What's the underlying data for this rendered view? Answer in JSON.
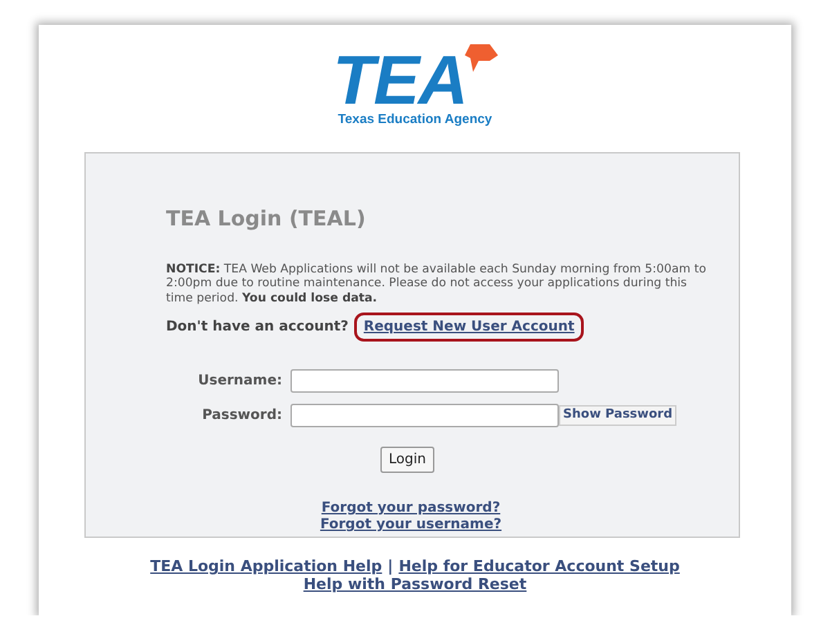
{
  "logo": {
    "wordmark": "TEA",
    "tagline": "Texas Education Agency"
  },
  "login": {
    "title": "TEA Login (TEAL)",
    "notice": "**NOTICE:**  TEA Web Applications will not be available each Sunday morning from 5:00am to 2:00pm due to routine maintenance. Please do not access your applications during this time period. **You could lose data.**",
    "account_prompt": "Don't have an account?",
    "request_link": {
      "label": "Request New User Account",
      "highlighted": true
    },
    "fields": [
      {
        "label": "Username:",
        "kind": "text"
      },
      {
        "label": "Password:",
        "kind": "password",
        "toggle": "Show Password"
      }
    ],
    "login_button": "Login",
    "forgot_links": [
      "Forgot your password?",
      "Forgot your username?"
    ]
  },
  "footer": {
    "links": [
      "TEA Login Application Help",
      "Help for Educator Account Setup",
      "Help with Password Reset"
    ],
    "separator": "|"
  }
}
